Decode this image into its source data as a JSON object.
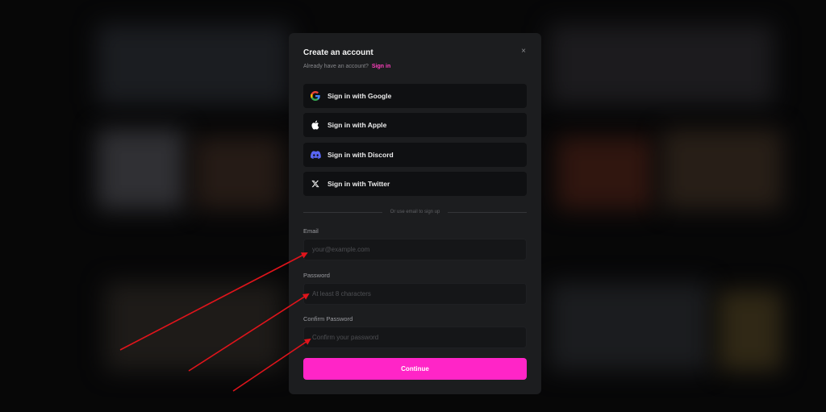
{
  "modal": {
    "title": "Create an account",
    "close_symbol": "×",
    "subtitle_text": "Already have an account?",
    "signin_link": "Sign in"
  },
  "social": [
    {
      "label": "Sign in with Google",
      "icon": "google-icon"
    },
    {
      "label": "Sign in with Apple",
      "icon": "apple-icon"
    },
    {
      "label": "Sign in with Discord",
      "icon": "discord-icon"
    },
    {
      "label": "Sign in with Twitter",
      "icon": "x-twitter-icon"
    }
  ],
  "divider_text": "Or use email to sign up",
  "form": {
    "email": {
      "label": "Email",
      "placeholder": "your@example.com",
      "value": ""
    },
    "password": {
      "label": "Password",
      "placeholder": "At least 8 characters",
      "value": ""
    },
    "confirm": {
      "label": "Confirm Password",
      "placeholder": "Confirm your password",
      "value": ""
    }
  },
  "continue_label": "Continue",
  "colors": {
    "accent": "#ff25c7",
    "link": "#ff3fbe",
    "annotation_arrow": "#e0141b",
    "modal_bg": "#1c1d1f"
  }
}
